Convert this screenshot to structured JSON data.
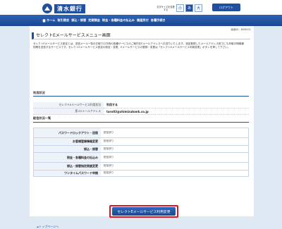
{
  "header": {
    "bank_name": "清水銀行",
    "font_size_label": "文字サイズを変更する",
    "font_sizes": [
      "小",
      "あ",
      "大"
    ],
    "logout_label": "ログアウト"
  },
  "nav": {
    "items": [
      "ホーム",
      "取引照会",
      "振込・振替",
      "定期預金",
      "税金・各種料金の払込み",
      "諸届受付",
      "各種手続き"
    ]
  },
  "screen_id": "画面ID：BSM001",
  "page_title": "セレクトEメールサービスメニュー画面",
  "description": "セレクトEメールサービス設定とは、送信メール一覧のお取り引き時の各種サービスのご案内をEメールアドレスへお送りいたします。追加登録したメールアドレス宛でにも本取引明細通知等を送信するサービスです。セレクトEメールサービス設定の設定・変更、Eメールサービスの登録・変更は「セレクトEメールサービス利用変更」ボタンを押して下さい。",
  "usage_section": {
    "heading": "利用状況",
    "rows": [
      {
        "key": "セレクトEメールサービス利用状況",
        "value": "利用する"
      },
      {
        "key": "第２Eメールアドレス",
        "value": "taro03@shimizubank.co.jp"
      }
    ]
  },
  "delivery_section": {
    "heading": "配信状況一覧",
    "rows": [
      {
        "name": "パスワードロックアウト・回復",
        "status": "配信済り"
      },
      {
        "name": "お客様登録情報変更",
        "status": "配信済り"
      },
      {
        "name": "振込・振替",
        "status": "配信済り"
      },
      {
        "name": "税金・各種料金の払込み",
        "status": "配信済り"
      },
      {
        "name": "振込・振替指定限度変更",
        "status": "配信済り"
      },
      {
        "name": "ワンタイムパスワード申請",
        "status": "配信済り"
      }
    ]
  },
  "change_button_label": "セレクトEメールサービス利用変更",
  "back_link_label": "トップページへ"
}
